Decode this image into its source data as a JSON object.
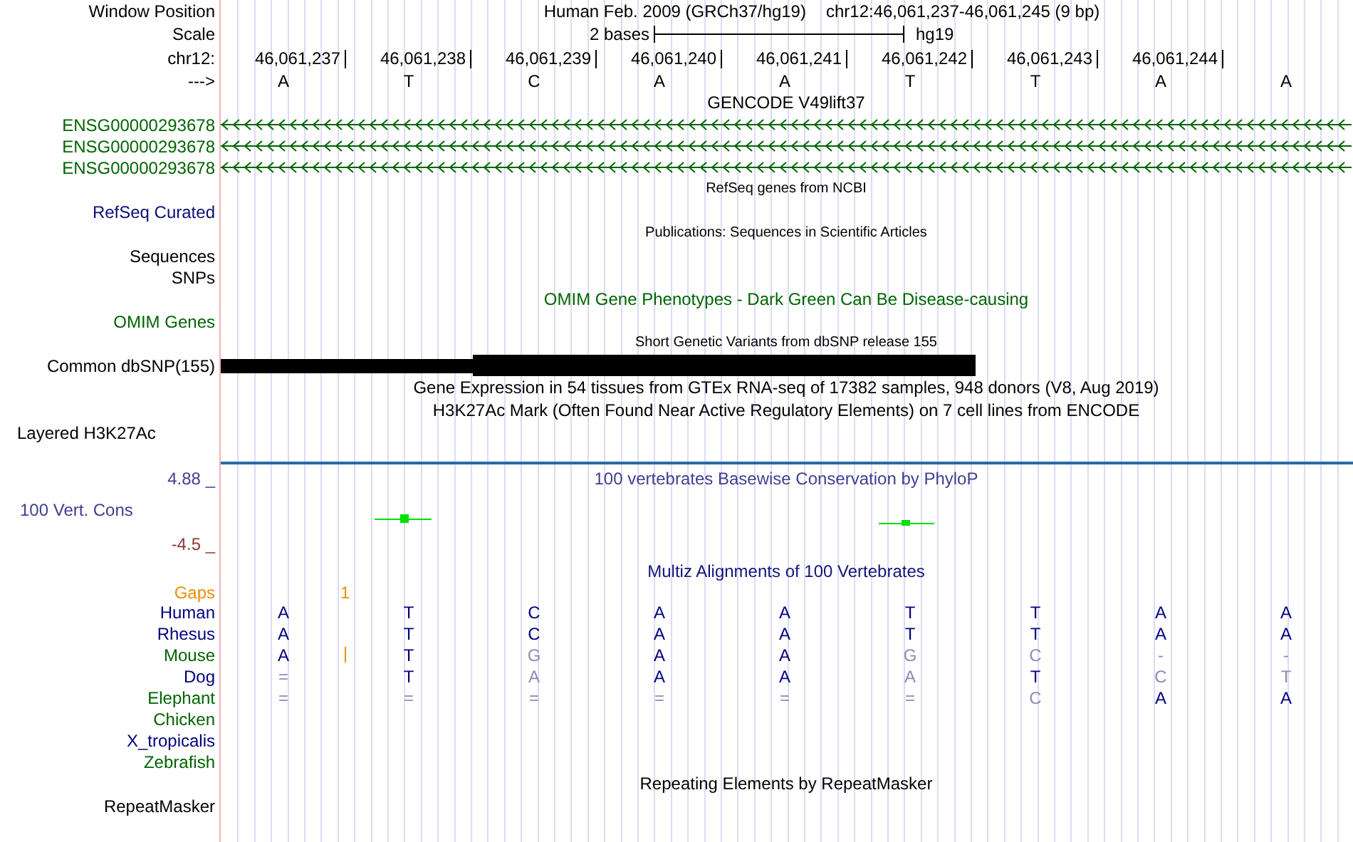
{
  "position_header": {
    "label": "Window Position",
    "title": "Human Feb. 2009 (GRCh37/hg19)",
    "range": "chr12:46,061,237-46,061,245 (9 bp)"
  },
  "scale": {
    "label": "Scale",
    "span": "2 bases",
    "assembly": "hg19"
  },
  "ruler": {
    "label": "chr12:",
    "positions": [
      "46,061,237",
      "46,061,238",
      "46,061,239",
      "46,061,240",
      "46,061,241",
      "46,061,242",
      "46,061,243",
      "46,061,244"
    ]
  },
  "sequence": {
    "label": "--->",
    "bases": [
      "A",
      "T",
      "C",
      "A",
      "A",
      "T",
      "T",
      "A",
      "A"
    ]
  },
  "tracks": [
    {
      "kind": "title",
      "text": "GENCODE V49lift37",
      "color": "#000000"
    },
    {
      "kind": "gene",
      "label": "ENSG00000293678",
      "color": "#006400"
    },
    {
      "kind": "gene",
      "label": "ENSG00000293678",
      "color": "#006400"
    },
    {
      "kind": "gene",
      "label": "ENSG00000293678",
      "color": "#006400"
    },
    {
      "kind": "subtitle",
      "text": "RefSeq genes from NCBI",
      "color": "#000000"
    },
    {
      "kind": "label",
      "text": "RefSeq Curated",
      "color": "#0c0c78"
    },
    {
      "kind": "subtitle",
      "text": "Publications: Sequences in Scientific Articles",
      "color": "#000000"
    },
    {
      "kind": "label",
      "text": "Sequences",
      "color": "#000000"
    },
    {
      "kind": "label",
      "text": "SNPs",
      "color": "#000000"
    },
    {
      "kind": "title",
      "text": "OMIM Gene Phenotypes - Dark Green Can Be Disease-causing",
      "color": "#006400"
    },
    {
      "kind": "label",
      "text": "OMIM Genes",
      "color": "#006400"
    },
    {
      "kind": "subtitle",
      "text": "Short Genetic Variants from dbSNP release 155",
      "color": "#000000"
    },
    {
      "kind": "variant",
      "label": "Common dbSNP(155)",
      "color": "#000000"
    },
    {
      "kind": "title",
      "text": "Gene Expression in 54 tissues from GTEx RNA-seq of 17382 samples, 948 donors (V8, Aug 2019)",
      "color": "#000000"
    },
    {
      "kind": "title",
      "text": "H3K27Ac Mark (Often Found Near Active Regulatory Elements) on 7 cell lines from ENCODE",
      "color": "#000000"
    },
    {
      "kind": "composite",
      "text": "Layered H3K27Ac",
      "color": "#000000"
    }
  ],
  "conservation": {
    "title": "100 vertebrates Basewise Conservation by PhyloP",
    "label": "100 Vert. Cons",
    "max": "4.88 _",
    "min": "-4.5 _"
  },
  "alignment": {
    "title": "Multiz Alignments of 100 Vertebrates",
    "gaps_label": "Gaps",
    "gaps_count": "1",
    "species": [
      {
        "name": "Human",
        "color": "#000080",
        "insertion": false,
        "bases": [
          {
            "base": "A",
            "match": true
          },
          {
            "base": "T",
            "match": true
          },
          {
            "base": "C",
            "match": true
          },
          {
            "base": "A",
            "match": true
          },
          {
            "base": "A",
            "match": true
          },
          {
            "base": "T",
            "match": true
          },
          {
            "base": "T",
            "match": true
          },
          {
            "base": "A",
            "match": true
          },
          {
            "base": "A",
            "match": true
          }
        ]
      },
      {
        "name": "Rhesus",
        "color": "#000080",
        "insertion": false,
        "bases": [
          {
            "base": "A",
            "match": true
          },
          {
            "base": "T",
            "match": true
          },
          {
            "base": "C",
            "match": true
          },
          {
            "base": "A",
            "match": true
          },
          {
            "base": "A",
            "match": true
          },
          {
            "base": "T",
            "match": true
          },
          {
            "base": "T",
            "match": true
          },
          {
            "base": "A",
            "match": true
          },
          {
            "base": "A",
            "match": true
          }
        ]
      },
      {
        "name": "Mouse",
        "color": "#006400",
        "insertion": true,
        "bases": [
          {
            "base": "A",
            "match": true
          },
          {
            "base": "T",
            "match": true
          },
          {
            "base": "G",
            "match": false
          },
          {
            "base": "A",
            "match": true
          },
          {
            "base": "A",
            "match": true
          },
          {
            "base": "G",
            "match": false
          },
          {
            "base": "C",
            "match": false
          },
          {
            "base": "-",
            "match": false
          },
          {
            "base": "-",
            "match": false
          }
        ]
      },
      {
        "name": "Dog",
        "color": "#000080",
        "insertion": false,
        "bases": [
          {
            "base": "=",
            "match": false
          },
          {
            "base": "T",
            "match": true
          },
          {
            "base": "A",
            "match": false
          },
          {
            "base": "A",
            "match": true
          },
          {
            "base": "A",
            "match": true
          },
          {
            "base": "A",
            "match": false
          },
          {
            "base": "T",
            "match": true
          },
          {
            "base": "C",
            "match": false
          },
          {
            "base": "T",
            "match": false
          }
        ]
      },
      {
        "name": "Elephant",
        "color": "#006400",
        "insertion": false,
        "bases": [
          {
            "base": "=",
            "match": false
          },
          {
            "base": "=",
            "match": false
          },
          {
            "base": "=",
            "match": false
          },
          {
            "base": "=",
            "match": false
          },
          {
            "base": "=",
            "match": false
          },
          {
            "base": "=",
            "match": false
          },
          {
            "base": "C",
            "match": false
          },
          {
            "base": "A",
            "match": true
          },
          {
            "base": "A",
            "match": true
          }
        ]
      },
      {
        "name": "Chicken",
        "color": "#006400",
        "insertion": false
      },
      {
        "name": "X_tropicalis",
        "color": "#000080",
        "insertion": false
      },
      {
        "name": "Zebrafish",
        "color": "#006400",
        "insertion": false
      }
    ]
  },
  "repeats": {
    "title": "Repeating Elements by RepeatMasker",
    "label": "RepeatMasker"
  }
}
